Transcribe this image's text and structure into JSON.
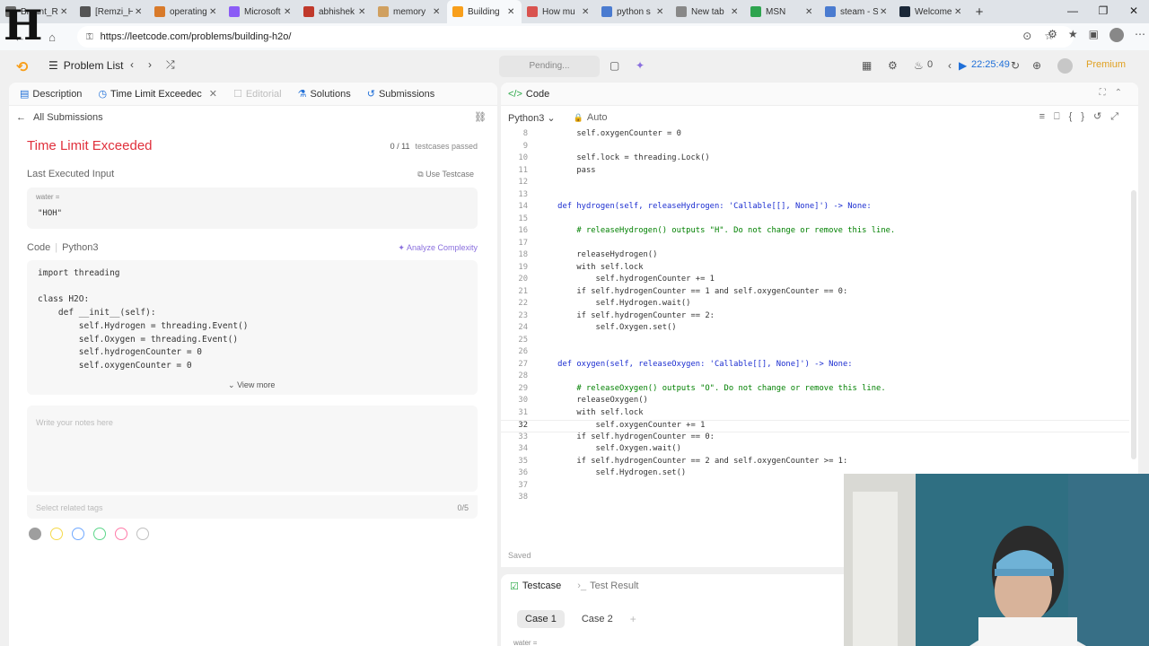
{
  "browser": {
    "tabs": [
      {
        "title": "Bryant_R",
        "icon_color": "#6b6b6b",
        "active": false
      },
      {
        "title": "[Remzi_H",
        "icon_color": "#555555",
        "active": false
      },
      {
        "title": "operating",
        "icon_color": "#d87a2a",
        "active": false
      },
      {
        "title": "Microsoft",
        "icon_color": "#8b5cf6",
        "active": false
      },
      {
        "title": "abhishek",
        "icon_color": "#c0392b",
        "active": false
      },
      {
        "title": "memory",
        "icon_color": "#d0a060",
        "active": false
      },
      {
        "title": "Building",
        "icon_color": "#f89f1b",
        "active": true
      },
      {
        "title": "How mu",
        "icon_color": "#d9534f",
        "active": false
      },
      {
        "title": "python s",
        "icon_color": "#4a7bd0",
        "active": false
      },
      {
        "title": "New tab",
        "icon_color": "#888888",
        "active": false
      },
      {
        "title": "MSN",
        "icon_color": "#2ea44f",
        "active": false
      },
      {
        "title": "steam - S",
        "icon_color": "#4a7bd0",
        "active": false
      },
      {
        "title": "Welcome",
        "icon_color": "#1b2838",
        "active": false
      }
    ],
    "url": "https://leetcode.com/problems/building-h2o/"
  },
  "watermark": "H",
  "header": {
    "problem_list": "Problem List",
    "pending": "Pending...",
    "streak": "0",
    "timer": "22:25:49",
    "premium": "Premium"
  },
  "left": {
    "tabs": {
      "description": "Description",
      "tle": "Time Limit Exceedec",
      "editorial": "Editorial",
      "solutions": "Solutions",
      "submissions": "Submissions"
    },
    "all_submissions": "All Submissions",
    "status": "Time Limit Exceeded",
    "passed_count": "0 / 11",
    "passed_label": "testcases passed",
    "last_input": "Last Executed Input",
    "use_testcase": "Use Testcase",
    "input_label": "water =",
    "input_value": "\"HOH\"",
    "code_label": "Code",
    "code_lang": "Python3",
    "analyze": "Analyze Complexity",
    "code_lines": [
      "import threading",
      "",
      "class H2O:",
      "    def __init__(self):",
      "        self.Hydrogen = threading.Event()",
      "        self.Oxygen = threading.Event()",
      "        self.hydrogenCounter = 0",
      "        self.oxygenCounter = 0"
    ],
    "view_more": "View more",
    "notes_placeholder": "Write your notes here",
    "tags_placeholder": "Select related tags",
    "tags_count": "0/5",
    "note_colors": [
      "#9e9e9e",
      "#f5d94a",
      "#6fa8ff",
      "#5cd68a",
      "#ff7aa8",
      "#bfbfbf"
    ]
  },
  "right": {
    "title": "Code",
    "language": "Python3",
    "auto": "Auto",
    "saved": "Saved",
    "lines": [
      {
        "n": "8",
        "t": "        self.oxygenCounter = 0"
      },
      {
        "n": "9",
        "t": ""
      },
      {
        "n": "10",
        "t": "        self.lock = threading.Lock()"
      },
      {
        "n": "11",
        "t": "        pass"
      },
      {
        "n": "12",
        "t": ""
      },
      {
        "n": "13",
        "t": ""
      },
      {
        "n": "14",
        "t": "    def hydrogen(self, releaseHydrogen: 'Callable[[], None]') -> None:"
      },
      {
        "n": "15",
        "t": ""
      },
      {
        "n": "16",
        "t": "        # releaseHydrogen() outputs \"H\". Do not change or remove this line."
      },
      {
        "n": "17",
        "t": ""
      },
      {
        "n": "18",
        "t": "        releaseHydrogen()"
      },
      {
        "n": "19",
        "t": "        with self.lock"
      },
      {
        "n": "20",
        "t": "            self.hydrogenCounter += 1"
      },
      {
        "n": "21",
        "t": "        if self.hydrogenCounter == 1 and self.oxygenCounter == 0:"
      },
      {
        "n": "22",
        "t": "            self.Hydrogen.wait()"
      },
      {
        "n": "23",
        "t": "        if self.hydrogenCounter == 2:"
      },
      {
        "n": "24",
        "t": "            self.Oxygen.set()"
      },
      {
        "n": "25",
        "t": ""
      },
      {
        "n": "26",
        "t": ""
      },
      {
        "n": "27",
        "t": "    def oxygen(self, releaseOxygen: 'Callable[[], None]') -> None:"
      },
      {
        "n": "28",
        "t": ""
      },
      {
        "n": "29",
        "t": "        # releaseOxygen() outputs \"O\". Do not change or remove this line."
      },
      {
        "n": "30",
        "t": "        releaseOxygen()"
      },
      {
        "n": "31",
        "t": "        with self.lock"
      },
      {
        "n": "32",
        "t": "            self.oxygenCounter += 1"
      },
      {
        "n": "33",
        "t": "        if self.hydrogenCounter == 0:"
      },
      {
        "n": "34",
        "t": "            self.Oxygen.wait()"
      },
      {
        "n": "35",
        "t": "        if self.hydrogenCounter == 2 and self.oxygenCounter >= 1:"
      },
      {
        "n": "36",
        "t": "            self.Hydrogen.set()"
      },
      {
        "n": "37",
        "t": ""
      },
      {
        "n": "38",
        "t": ""
      }
    ],
    "current_line": "32"
  },
  "testpanel": {
    "testcase": "Testcase",
    "test_result": "Test Result",
    "case1": "Case 1",
    "case2": "Case 2",
    "water_label": "water ="
  },
  "colors": {
    "accent": "#f89f1b",
    "error": "#e0303c",
    "timer": "#1f6fd8",
    "premium": "#e0a020"
  }
}
